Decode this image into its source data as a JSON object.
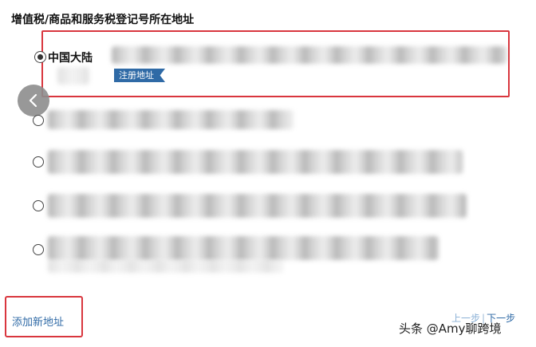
{
  "section_title": "增值税/商品和服务税登记号所在地址",
  "selected_address": {
    "country": "中国大陆",
    "tag": "注册地址"
  },
  "actions": {
    "add_new_address": "添加新地址",
    "prev": "上一步",
    "separator": "|",
    "next": "下一步"
  },
  "watermark": "头条 @Amy聊跨境",
  "colors": {
    "highlight_border": "#d9363e",
    "tag_bg": "#2f6aa6",
    "link": "#2f6aa6"
  }
}
